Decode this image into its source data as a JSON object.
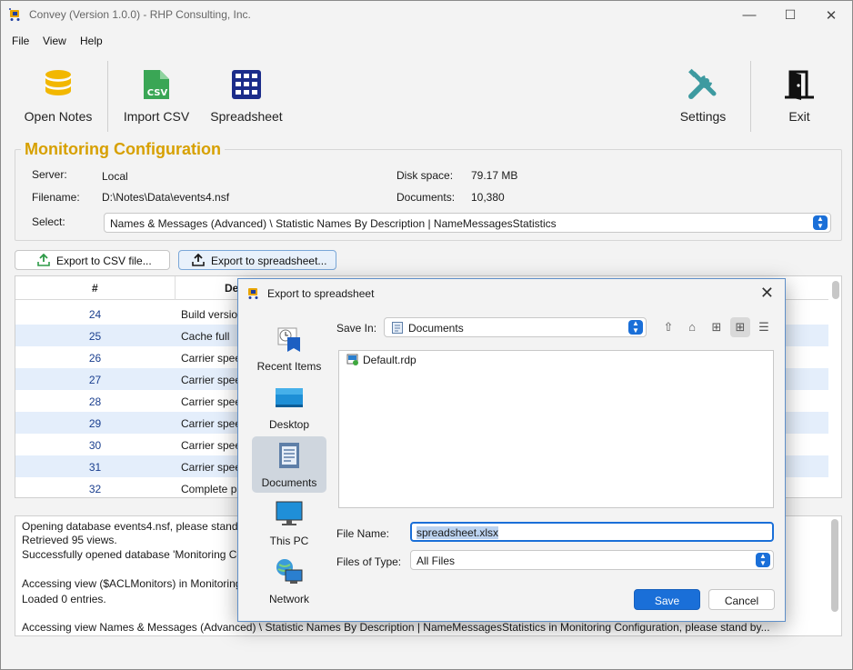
{
  "window": {
    "title": "Convey (Version 1.0.0) - RHP Consulting, Inc.",
    "minimize": "—",
    "maximize": "☐",
    "close": "✕"
  },
  "menu": [
    "File",
    "View",
    "Help"
  ],
  "toolbar": {
    "open_notes": "Open Notes",
    "import_csv": "Import CSV",
    "spreadsheet": "Spreadsheet",
    "settings": "Settings",
    "exit": "Exit",
    "csv_badge": "CSV"
  },
  "config": {
    "legend": "Monitoring Configuration",
    "server_label": "Server:",
    "server_value": "Local",
    "filename_label": "Filename:",
    "filename_value": "D:\\Notes\\Data\\events4.nsf",
    "select_label": "Select:",
    "select_value": "Names & Messages (Advanced) \\ Statistic Names By Description | NameMessagesStatistics",
    "disk_label": "Disk space:",
    "disk_value": "79.17 MB",
    "docs_label": "Documents:",
    "docs_value": "10,380"
  },
  "actions": {
    "export_csv": "Export to CSV file...",
    "export_sheet": "Export to spreadsheet..."
  },
  "grid": {
    "columns": [
      "#",
      "De"
    ],
    "rows": [
      {
        "n": "24",
        "d": "Build version"
      },
      {
        "n": "25",
        "d": "Cache full"
      },
      {
        "n": "26",
        "d": "Carrier speed"
      },
      {
        "n": "27",
        "d": "Carrier speed"
      },
      {
        "n": "28",
        "d": "Carrier speed"
      },
      {
        "n": "29",
        "d": "Carrier speed"
      },
      {
        "n": "30",
        "d": "Carrier speed"
      },
      {
        "n": "31",
        "d": "Carrier speed"
      },
      {
        "n": "32",
        "d": "Complete pa"
      }
    ]
  },
  "log": [
    "Opening database events4.nsf, please stand b",
    "Retrieved 95 views.",
    "Successfully opened database 'Monitoring Co",
    "",
    "Accessing view ($ACLMonitors) in Monitoring",
    "Loaded 0 entries.",
    "",
    "Accessing view Names & Messages (Advanced) \\ Statistic Names By Description | NameMessagesStatistics in Monitoring Configuration, please stand by..."
  ],
  "dialog": {
    "title": "Export to spreadsheet",
    "places": [
      "Recent Items",
      "Desktop",
      "Documents",
      "This PC",
      "Network"
    ],
    "save_in_label": "Save In:",
    "save_in_value": "Documents",
    "files": [
      "Default.rdp"
    ],
    "file_name_label": "File Name:",
    "file_name_value": "spreadsheet.xlsx",
    "file_type_label": "Files of Type:",
    "file_type_value": "All Files",
    "save": "Save",
    "cancel": "Cancel"
  }
}
